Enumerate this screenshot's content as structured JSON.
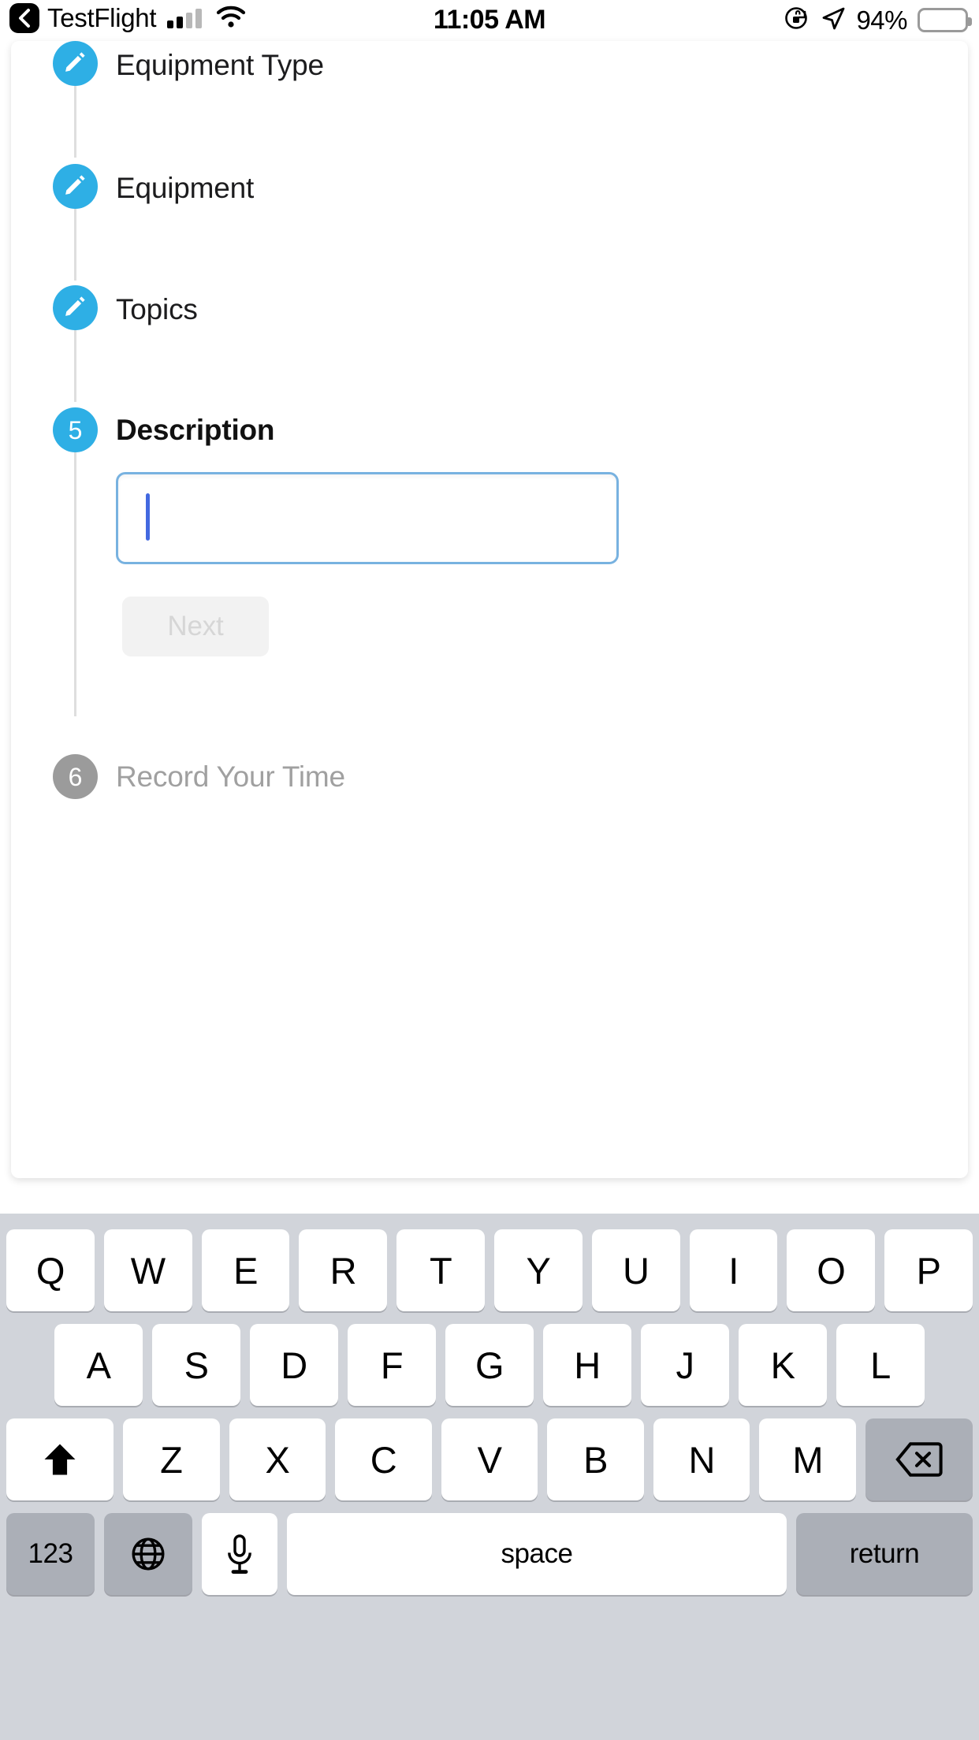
{
  "status_bar": {
    "back_app_label": "TestFlight",
    "back_icon": "chevron-left-icon",
    "signal_icon": "cellular-signal-icon",
    "wifi_icon": "wifi-icon",
    "time": "11:05 AM",
    "rotation_lock_icon": "rotation-lock-icon",
    "location_icon": "location-arrow-icon",
    "battery_percent": "94%",
    "battery_icon": "battery-full-icon"
  },
  "timeline": {
    "steps": [
      {
        "id": "equipment-type",
        "label": "Equipment Type",
        "state": "done",
        "marker": "pencil-icon"
      },
      {
        "id": "equipment",
        "label": "Equipment",
        "state": "done",
        "marker": "pencil-icon"
      },
      {
        "id": "topics",
        "label": "Topics",
        "state": "done",
        "marker": "pencil-icon"
      },
      {
        "id": "description",
        "label": "Description",
        "state": "active",
        "marker": "5"
      },
      {
        "id": "record-time",
        "label": "Record Your Time",
        "state": "pending",
        "marker": "6"
      }
    ]
  },
  "description_form": {
    "input_value": "",
    "input_placeholder": "",
    "next_label": "Next",
    "next_disabled": true
  },
  "keyboard": {
    "row1": [
      "Q",
      "W",
      "E",
      "R",
      "T",
      "Y",
      "U",
      "I",
      "O",
      "P"
    ],
    "row2": [
      "A",
      "S",
      "D",
      "F",
      "G",
      "H",
      "J",
      "K",
      "L"
    ],
    "row3_letters": [
      "Z",
      "X",
      "C",
      "V",
      "B",
      "N",
      "M"
    ],
    "shift_icon": "shift-up-arrow-icon",
    "backspace_icon": "backspace-delete-icon",
    "numeric_label": "123",
    "globe_icon": "globe-language-icon",
    "mic_icon": "microphone-icon",
    "space_label": "space",
    "return_label": "return"
  },
  "colors": {
    "accent_blue": "#2EAFE5",
    "pending_gray": "#9b9b9b",
    "field_border": "#78B2E0",
    "caret_blue": "#4369E0",
    "keyboard_bg": "#D1D4DA",
    "key_dark": "#ABAFB7",
    "next_bg": "#F2F2F2",
    "next_text": "#D6D6D6"
  }
}
